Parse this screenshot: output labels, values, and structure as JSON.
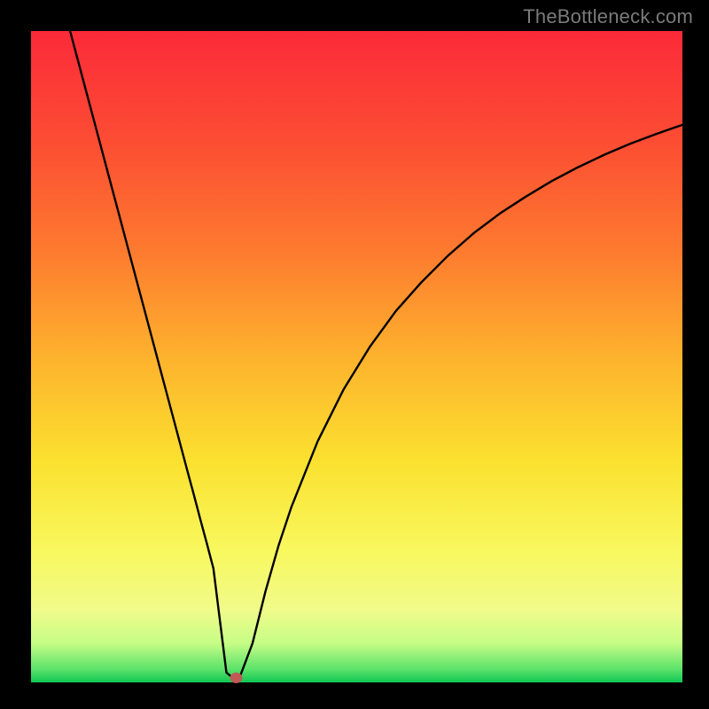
{
  "watermark": "TheBottleneck.com",
  "chart_data": {
    "type": "line",
    "title": "",
    "xlabel": "",
    "ylabel": "",
    "xlim": [
      0,
      100
    ],
    "ylim": [
      0,
      100
    ],
    "grid": false,
    "legend": false,
    "series": [
      {
        "name": "bottleneck-curve",
        "color": "#000000",
        "x": [
          6,
          8,
          10,
          12,
          14,
          16,
          18,
          20,
          22,
          24,
          25,
          26,
          27,
          28,
          29,
          30,
          31,
          32,
          34,
          36,
          38,
          40,
          44,
          48,
          52,
          56,
          60,
          64,
          68,
          72,
          76,
          80,
          84,
          88,
          92,
          96,
          100
        ],
        "y": [
          100,
          92.5,
          85,
          77.5,
          70,
          62.5,
          55,
          47.5,
          40,
          32.5,
          28.8,
          25,
          21.3,
          17.5,
          9.5,
          1.5,
          0.7,
          0.7,
          6,
          14,
          21,
          27,
          37,
          45,
          51.5,
          57,
          61.5,
          65.5,
          69,
          72,
          74.6,
          77,
          79.1,
          81,
          82.7,
          84.2,
          85.6
        ]
      }
    ],
    "marker": {
      "x": 31.5,
      "y": 0.7,
      "color": "#bf5a56",
      "rx": 7,
      "ry": 6
    },
    "background_gradient": {
      "orientation": "vertical",
      "stops": [
        {
          "pos": 0.0,
          "color": "#fb2a39"
        },
        {
          "pos": 0.17,
          "color": "#fc4d33"
        },
        {
          "pos": 0.34,
          "color": "#fd7b2f"
        },
        {
          "pos": 0.5,
          "color": "#fdb22d"
        },
        {
          "pos": 0.66,
          "color": "#fbe12f"
        },
        {
          "pos": 0.8,
          "color": "#f8f85f"
        },
        {
          "pos": 0.89,
          "color": "#f0fb8a"
        },
        {
          "pos": 0.94,
          "color": "#c6fd86"
        },
        {
          "pos": 0.98,
          "color": "#5be26a"
        },
        {
          "pos": 1.0,
          "color": "#0fc754"
        }
      ]
    }
  }
}
